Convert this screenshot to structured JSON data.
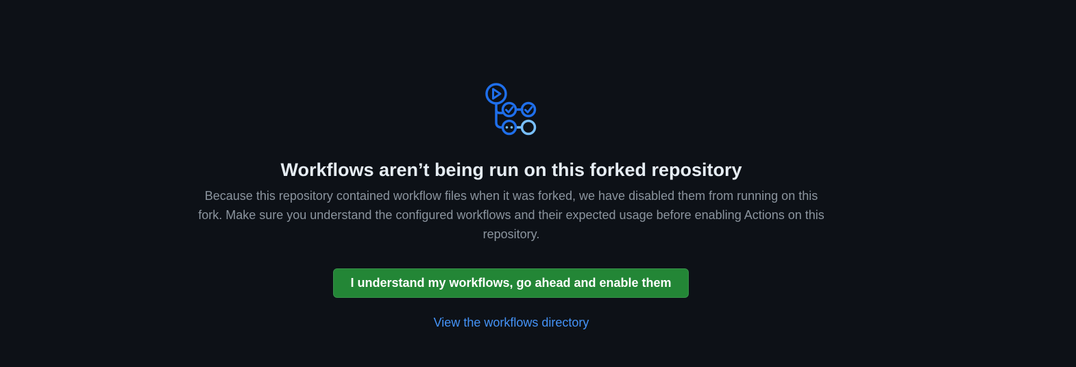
{
  "blankslate": {
    "icon": "workflow-icon",
    "title": "Workflows aren’t being run on this forked repository",
    "description": "Because this repository contained workflow files when it was forked, we have disabled them from running on this fork. Make sure you understand the configured workflows and their expected usage before enabling Actions on this repository.",
    "enable_button_label": "I understand my workflows, go ahead and enable them",
    "view_link_label": "View the workflows directory"
  },
  "colors": {
    "background": "#0d1117",
    "title": "#e6edf3",
    "description": "#8b949e",
    "button": "#238636",
    "link": "#4493f8",
    "icon_primary": "#1f6feb",
    "icon_secondary": "#79c0ff"
  }
}
